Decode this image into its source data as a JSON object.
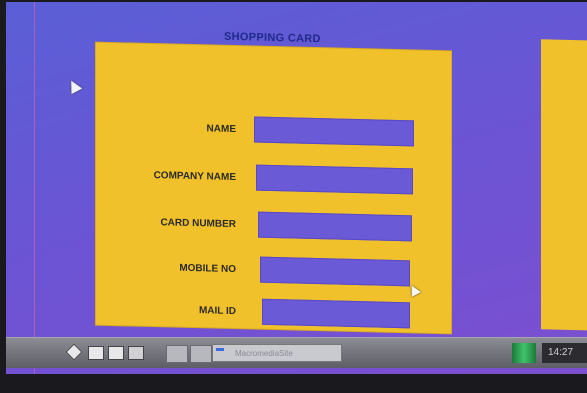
{
  "window": {
    "title": "SHOPPING CARD"
  },
  "form": {
    "fields": [
      {
        "label": "NAME",
        "value": ""
      },
      {
        "label": "COMPANY NAME",
        "value": ""
      },
      {
        "label": "CARD NUMBER",
        "value": ""
      },
      {
        "label": "MOBILE NO",
        "value": ""
      },
      {
        "label": "MAIL ID",
        "value": ""
      }
    ]
  },
  "taskbar": {
    "window_button_label": "MacromediaSite",
    "clock": "14:27"
  },
  "colors": {
    "screen_bg": "#6a55d4",
    "card_bg": "#f0c12a",
    "field_bg": "#6b5ad6",
    "title_color": "#1f2a8a"
  }
}
